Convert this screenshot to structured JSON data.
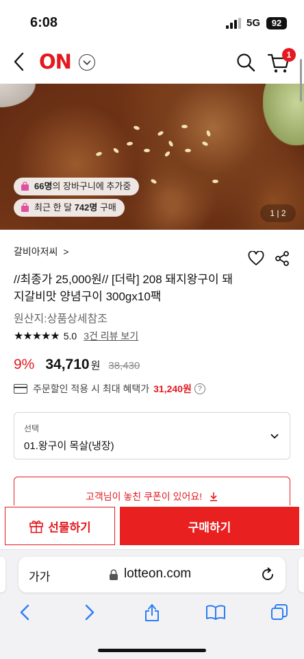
{
  "status": {
    "time": "6:08",
    "network": "5G",
    "battery": "92"
  },
  "header": {
    "logo": "ON",
    "cart_count": "1"
  },
  "hero": {
    "cart_added_count": "66명",
    "cart_added_text": "의 장바구니에 추가중",
    "monthly_prefix": "최근 한 달 ",
    "monthly_count": "742명",
    "monthly_suffix": " 구매",
    "image_counter": "1 | 2"
  },
  "product": {
    "brand": "갈비아저씨",
    "title": "//최종가 25,000원// [더락] 208 돼지왕구이 돼지갈비맛 양념구이 300gx10팩",
    "origin": "원산지:상품상세참조",
    "stars": "★★★★★",
    "rating": "5.0",
    "review_link": "3건 리뷰 보기",
    "discount": "9%",
    "price": "34,710",
    "currency": "원",
    "original_price": "38,430",
    "benefit_text": "주문할인 적용 시 최대 혜택가",
    "benefit_amount": "31,240원"
  },
  "option": {
    "label": "선택",
    "value": "01.왕구이 목살(냉장)"
  },
  "coupon": {
    "text": "고객님이 놓친 쿠폰이 있어요!"
  },
  "actions": {
    "gift_label": "선물하기",
    "buy_label": "구매하기"
  },
  "browser": {
    "text_size": "가가",
    "host": "lotteon.com"
  },
  "colors": {
    "accent": "#e3191f",
    "buy": "#e8201f"
  }
}
